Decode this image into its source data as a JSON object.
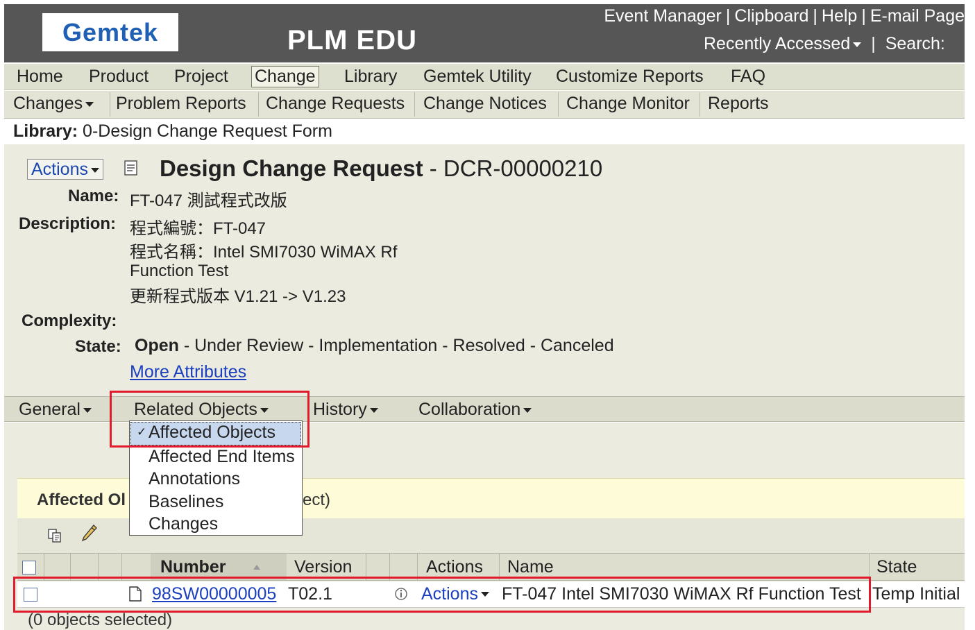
{
  "header": {
    "logo_text": "Gemtek",
    "app_title": "PLM EDU",
    "links": [
      "Event Manager",
      "Clipboard",
      "Help",
      "E-mail Page"
    ],
    "separator": "|",
    "recently_accessed": "Recently Accessed",
    "search_label": "Search:"
  },
  "nav": {
    "main": [
      "Home",
      "Product",
      "Project",
      "Change",
      "Library",
      "Gemtek Utility",
      "Customize Reports",
      "FAQ"
    ],
    "active": "Change",
    "sub_menu_label": "Changes",
    "sub": [
      "Problem Reports",
      "Change Requests",
      "Change Notices",
      "Change Monitor",
      "Reports"
    ]
  },
  "breadcrumb": {
    "label": "Library:",
    "value": "0-Design Change Request Form"
  },
  "object": {
    "actions_label": "Actions",
    "type": "Design Change Request",
    "dash": " - ",
    "number": "DCR-00000210",
    "name_label": "Name:",
    "name": "FT-047 測試程式改版",
    "description_label": "Description:",
    "description_lines": [
      "程式編號：FT-047",
      "程式名稱：Intel SMI7030 WiMAX Rf",
      "Function Test",
      "更新程式版本 V1.21 -> V1.23"
    ],
    "complexity_label": "Complexity:",
    "complexity": "",
    "state_label": "State:",
    "states": [
      "Open",
      "Under Review",
      "Implementation",
      "Resolved",
      "Canceled"
    ],
    "current_state": "Open",
    "more_attributes": "More Attributes"
  },
  "tabs": {
    "items": [
      "General",
      "Related Objects",
      "History",
      "Collaboration"
    ],
    "active": "Related Objects"
  },
  "dropdown": {
    "options": [
      "Affected Objects",
      "Affected End Items",
      "Annotations",
      "Baselines",
      "Changes"
    ],
    "selected": "Affected Objects",
    "check_mark": "✓"
  },
  "panel": {
    "title_visible": "Affected Ol",
    "title_rest_visible": "ect)"
  },
  "table": {
    "columns": [
      "Number",
      "Version",
      "Actions",
      "Name",
      "State"
    ],
    "rows": [
      {
        "number": "98SW00000005",
        "version": "T02.1",
        "actions": "Actions",
        "name": "FT-047 Intel SMI7030 WiMAX Rf Function Test",
        "state": "Temp Initial"
      }
    ],
    "selection_status": "(0 objects selected)"
  },
  "colors": {
    "header_bg": "#565656",
    "logo_blue": "#1f5fb4",
    "link_blue": "#1b3fbf",
    "highlight_red": "#e11b2b",
    "panel_title_bg": "#fdfbd8"
  }
}
